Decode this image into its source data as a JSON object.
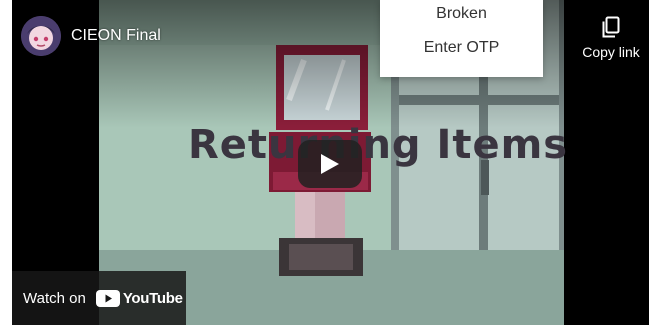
{
  "video": {
    "title": "CIEON Final",
    "overlay_text": "Returning Items",
    "copy_link_label": "Copy link",
    "watch_on_label": "Watch on",
    "youtube_label": "YouTube"
  },
  "menu": {
    "items": [
      {
        "label": "Broken"
      },
      {
        "label": "Enter OTP"
      }
    ]
  },
  "colors": {
    "background": "#000000",
    "scene_wall": "#a9c7b8",
    "kiosk": "#8b1e3a",
    "youtube_red": "#ff0000"
  },
  "icons": {
    "copy": "copy-icon",
    "play": "play-icon",
    "youtube": "youtube-logo-icon"
  }
}
